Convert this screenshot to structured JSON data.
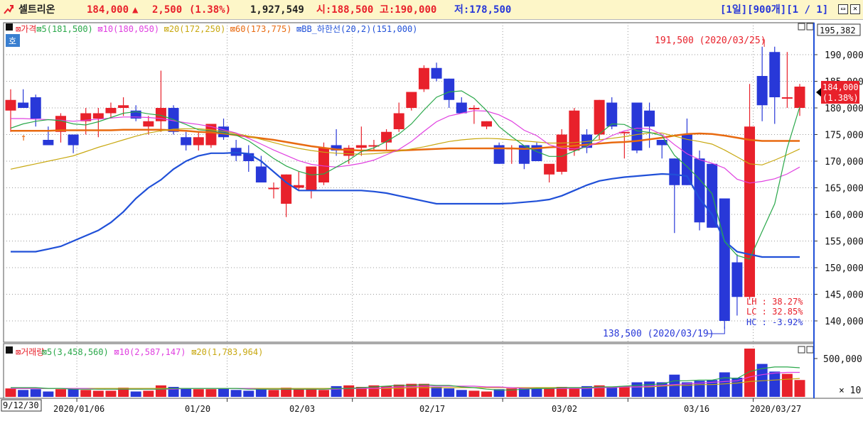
{
  "title_bar": {
    "stock_name": "셀트리온",
    "price": "184,000",
    "change_symbol": "▲",
    "change": "2,500",
    "change_pct": "(1.38%)",
    "volume": "1,927,549",
    "open": "시:188,500",
    "high": "고:190,000",
    "low": "저:178,500",
    "period_controls": "[1일][900개][1 / 1]",
    "colors": {
      "up": "#e8212b",
      "down": "#2838d8",
      "bg": "#fdf6c8"
    }
  },
  "price_legend": [
    {
      "text": "⊠가격",
      "color": "#e8212b"
    },
    {
      "text": "⊠5(181,500)",
      "color": "#2aa84a"
    },
    {
      "text": "⊠10(180,050)",
      "color": "#e040e0"
    },
    {
      "text": "⊠20(172,250)",
      "color": "#c8a810"
    },
    {
      "text": "⊠60(173,775)",
      "color": "#e86a10"
    },
    {
      "text": "⊠BB_하한선(20,2)(151,000)",
      "color": "#2050d8"
    }
  ],
  "price_axis": {
    "ticks": [
      "190,000",
      "185,000",
      "180,000",
      "175,000",
      "170,000",
      "165,000",
      "160,000",
      "155,000",
      "150,000",
      "145,000",
      "140,000"
    ],
    "top_label": "195,382",
    "current_price": "184,000",
    "current_pct": "(1.38%)"
  },
  "annotations": {
    "max": "191,500 (2020/03/25)",
    "min": "138,500 (2020/03/19)",
    "lh": "LH : 38.27%",
    "lc": "LC : 32.85%",
    "hc": "HC : -3.92%",
    "small_label": "호"
  },
  "volume_legend": [
    {
      "text": "⊠거래량",
      "color": "#e8212b"
    },
    {
      "text": "⊠5(3,458,560)",
      "color": "#2aa84a"
    },
    {
      "text": "⊠10(2,587,147)",
      "color": "#e040e0"
    },
    {
      "text": "⊠20(1,783,964)",
      "color": "#c8a810"
    }
  ],
  "volume_axis": {
    "ticks": [
      "500,000"
    ],
    "multiplier": "× 10"
  },
  "x_axis": {
    "first_label": "9/12/30",
    "labels": [
      "2020/01/06",
      "01/20",
      "02/03",
      "02/17",
      "03/02",
      "03/16",
      "2020/03/27"
    ]
  },
  "chart_data": {
    "type": "candlestick",
    "ylim": [
      134000,
      196000
    ],
    "candles": [
      [
        179500,
        183500,
        175500,
        181500
      ],
      [
        181000,
        183500,
        180000,
        180000
      ],
      [
        182000,
        182500,
        176500,
        178000
      ],
      [
        174000,
        176500,
        173000,
        173000
      ],
      [
        175500,
        179000,
        173500,
        178500
      ],
      [
        175000,
        175000,
        171500,
        173000
      ],
      [
        177500,
        180000,
        175000,
        179000
      ],
      [
        178000,
        180000,
        174500,
        179000
      ],
      [
        179000,
        181000,
        178000,
        180000
      ],
      [
        180000,
        182000,
        178500,
        180500
      ],
      [
        179500,
        180500,
        177500,
        178000
      ],
      [
        176500,
        178500,
        175000,
        177500
      ],
      [
        177500,
        187000,
        175500,
        180000
      ],
      [
        180000,
        180500,
        175000,
        175500
      ],
      [
        174500,
        175500,
        172000,
        173000
      ],
      [
        173000,
        175500,
        172000,
        174500
      ],
      [
        173000,
        177000,
        172500,
        177000
      ],
      [
        176500,
        178000,
        174000,
        174500
      ],
      [
        172500,
        174000,
        170000,
        171000
      ],
      [
        171500,
        173000,
        168000,
        170000
      ],
      [
        169000,
        171000,
        166000,
        166000
      ],
      [
        165000,
        166000,
        163000,
        165000
      ],
      [
        162000,
        167500,
        159500,
        167500
      ],
      [
        165000,
        168000,
        164500,
        165500
      ],
      [
        164500,
        169000,
        163000,
        169000
      ],
      [
        166000,
        173500,
        165500,
        172500
      ],
      [
        173000,
        176000,
        171000,
        172000
      ],
      [
        171000,
        173000,
        169500,
        172500
      ],
      [
        172500,
        176500,
        171000,
        173000
      ],
      [
        173000,
        174000,
        172000,
        173000
      ],
      [
        173500,
        176000,
        172000,
        175500
      ],
      [
        176000,
        181000,
        175500,
        179000
      ],
      [
        180000,
        183000,
        179500,
        183000
      ],
      [
        183500,
        188000,
        183000,
        187500
      ],
      [
        187500,
        188500,
        185000,
        185500
      ],
      [
        185500,
        185500,
        180000,
        181500
      ],
      [
        181000,
        182000,
        179000,
        179000
      ],
      [
        180000,
        180500,
        177000,
        180000
      ],
      [
        176500,
        177500,
        176000,
        177500
      ],
      [
        173000,
        173500,
        169500,
        169500
      ],
      [
        172500,
        173000,
        169500,
        172500
      ],
      [
        173000,
        173000,
        168500,
        169500
      ],
      [
        173000,
        173500,
        170000,
        170000
      ],
      [
        167500,
        169000,
        166000,
        169500
      ],
      [
        168000,
        176000,
        167500,
        175000
      ],
      [
        172000,
        180000,
        171000,
        179500
      ],
      [
        175000,
        176000,
        171500,
        172500
      ],
      [
        175000,
        181500,
        174000,
        181500
      ],
      [
        181000,
        182000,
        176000,
        176500
      ],
      [
        175500,
        175500,
        170500,
        175500
      ],
      [
        181000,
        181000,
        171500,
        172000
      ],
      [
        179500,
        181000,
        172500,
        176500
      ],
      [
        174000,
        174000,
        170500,
        173000
      ],
      [
        170500,
        170500,
        156500,
        165500
      ],
      [
        175000,
        178000,
        165500,
        165500
      ],
      [
        170500,
        172000,
        157000,
        158500
      ],
      [
        169500,
        169500,
        157500,
        157500
      ],
      [
        163000,
        163000,
        138500,
        140000
      ],
      [
        151000,
        152500,
        141000,
        144500
      ],
      [
        144500,
        184500,
        144000,
        176500
      ],
      [
        186000,
        191500,
        177500,
        180500
      ],
      [
        190500,
        191500,
        177000,
        182000
      ],
      [
        182000,
        190500,
        180000,
        182000
      ],
      [
        180000,
        184500,
        178500,
        184000
      ]
    ],
    "ma5": [
      176200,
      177000,
      177500,
      177800,
      177600,
      177000,
      176800,
      177400,
      178200,
      179000,
      179300,
      178900,
      178600,
      177800,
      176900,
      175900,
      175700,
      175300,
      174900,
      173800,
      172200,
      170500,
      169100,
      168100,
      167400,
      167600,
      168900,
      170200,
      171800,
      172500,
      173700,
      175100,
      177000,
      179600,
      182000,
      183000,
      183200,
      181800,
      179500,
      176500,
      174600,
      172900,
      171800,
      170900,
      170900,
      171900,
      172800,
      175100,
      177000,
      176900,
      175700,
      175400,
      174800,
      171100,
      169000,
      166600,
      163900,
      154900,
      152300,
      151600,
      156800,
      162000,
      172500,
      180200
    ],
    "ma10": [
      178000,
      178000,
      177900,
      177800,
      177700,
      177500,
      177700,
      177900,
      178100,
      178300,
      178300,
      178200,
      178000,
      177600,
      177200,
      176900,
      176500,
      175900,
      175300,
      174300,
      173200,
      172100,
      171100,
      170100,
      169400,
      169100,
      168900,
      169200,
      169600,
      170200,
      171200,
      172200,
      173700,
      175600,
      177400,
      178500,
      179000,
      179500,
      179400,
      178700,
      177500,
      175800,
      174800,
      173100,
      172400,
      172300,
      172700,
      173600,
      174800,
      175700,
      176200,
      176100,
      175000,
      173100,
      171400,
      170300,
      169600,
      168700,
      166600,
      165900,
      166200,
      166700,
      167600,
      168900
    ],
    "ma20": [
      168500,
      169000,
      169500,
      170000,
      170500,
      171000,
      171800,
      172600,
      173300,
      174000,
      174700,
      175300,
      175700,
      176000,
      176100,
      176100,
      175900,
      175600,
      175200,
      174700,
      174100,
      173500,
      172900,
      172400,
      172000,
      171700,
      171500,
      171400,
      171300,
      171400,
      171600,
      171900,
      172300,
      172700,
      173200,
      173700,
      174000,
      174200,
      174300,
      174200,
      174000,
      173800,
      173600,
      173400,
      173400,
      173500,
      173700,
      174000,
      174300,
      174600,
      175000,
      175300,
      175300,
      174700,
      174100,
      173700,
      173200,
      172100,
      170800,
      169500,
      169300,
      170200,
      171200,
      172300
    ],
    "ma60": [
      175700,
      175700,
      175700,
      175700,
      175800,
      175800,
      175800,
      175800,
      175800,
      175900,
      175900,
      175900,
      175900,
      175800,
      175700,
      175500,
      175400,
      175200,
      174900,
      174600,
      174300,
      174000,
      173600,
      173200,
      172800,
      172500,
      172200,
      172100,
      172000,
      172000,
      172000,
      172000,
      172100,
      172200,
      172300,
      172400,
      172400,
      172400,
      172400,
      172400,
      172400,
      172300,
      172400,
      172600,
      172700,
      172900,
      173100,
      173300,
      173500,
      173600,
      173800,
      174100,
      174400,
      174800,
      175100,
      175200,
      175100,
      174800,
      174400,
      174000,
      173800,
      173800,
      173800,
      173800
    ],
    "bb_lower": [
      153000,
      153000,
      153000,
      153500,
      154000,
      155000,
      156000,
      157000,
      158500,
      160500,
      163000,
      165000,
      166500,
      168500,
      170000,
      171000,
      171500,
      171500,
      171600,
      171400,
      170000,
      168000,
      166000,
      164500,
      164500,
      164500,
      164500,
      164500,
      164500,
      164300,
      164000,
      163500,
      163000,
      162500,
      162000,
      162000,
      162000,
      162000,
      162000,
      162000,
      162100,
      162300,
      162500,
      162800,
      163500,
      164500,
      165500,
      166300,
      166700,
      167000,
      167200,
      167400,
      167600,
      167500,
      167200,
      163000,
      160000,
      155000,
      153000,
      152500,
      152000,
      152000,
      152000,
      152000
    ],
    "volume": [
      11,
      9,
      10,
      7,
      10,
      10,
      9,
      8,
      8,
      12,
      7,
      8,
      15,
      13,
      11,
      10,
      10,
      11,
      9,
      8,
      10,
      9,
      12,
      10,
      11,
      9,
      14,
      15,
      13,
      15,
      14,
      16,
      17,
      17,
      13,
      11,
      9,
      8,
      7,
      10,
      11,
      12,
      11,
      12,
      13,
      12,
      14,
      15,
      12,
      14,
      19,
      20,
      19,
      29,
      19,
      21,
      22,
      32,
      25,
      63,
      43,
      33,
      30,
      22
    ],
    "vol_ma5": [
      12,
      12,
      12,
      11,
      11,
      10,
      10,
      10,
      10,
      10,
      10,
      10,
      10,
      11,
      11,
      11,
      11,
      11,
      11,
      10,
      10,
      10,
      10,
      10,
      10,
      10,
      11,
      11,
      12,
      13,
      14,
      15,
      15,
      16,
      15,
      15,
      13,
      12,
      10,
      9,
      9,
      10,
      11,
      11,
      12,
      12,
      12,
      13,
      13,
      14,
      15,
      16,
      17,
      21,
      21,
      22,
      22,
      25,
      24,
      33,
      37,
      39,
      39,
      38
    ],
    "vol_ma10": [
      11,
      11,
      11,
      11,
      11,
      11,
      11,
      10,
      10,
      10,
      10,
      10,
      10,
      10,
      11,
      11,
      11,
      11,
      11,
      11,
      10,
      10,
      10,
      10,
      10,
      10,
      10,
      11,
      11,
      11,
      12,
      13,
      13,
      14,
      14,
      14,
      14,
      14,
      13,
      13,
      12,
      11,
      11,
      11,
      11,
      11,
      11,
      12,
      12,
      13,
      13,
      14,
      15,
      16,
      17,
      18,
      19,
      20,
      21,
      26,
      29,
      31,
      32,
      32
    ],
    "vol_ma20": [
      11,
      11,
      11,
      11,
      11,
      11,
      11,
      11,
      11,
      11,
      11,
      11,
      11,
      11,
      11,
      11,
      11,
      11,
      11,
      11,
      11,
      11,
      11,
      11,
      11,
      11,
      11,
      11,
      11,
      11,
      11,
      11,
      12,
      12,
      12,
      12,
      12,
      12,
      12,
      12,
      12,
      12,
      12,
      12,
      12,
      12,
      12,
      13,
      13,
      13,
      13,
      13,
      14,
      15,
      15,
      16,
      16,
      17,
      18,
      20,
      21,
      22,
      23,
      24
    ]
  }
}
